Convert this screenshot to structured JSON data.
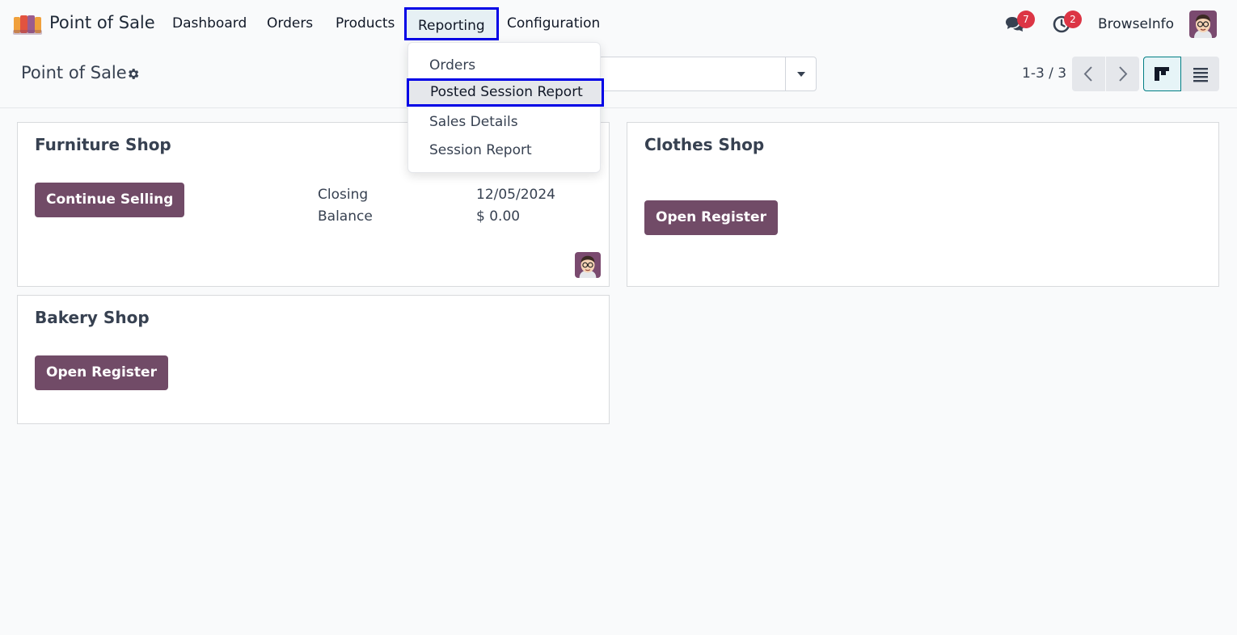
{
  "navbar": {
    "app_name": "Point of Sale",
    "menu": [
      {
        "label": "Dashboard"
      },
      {
        "label": "Orders"
      },
      {
        "label": "Products"
      },
      {
        "label": "Reporting"
      },
      {
        "label": "Configuration"
      }
    ],
    "messages_badge": "7",
    "activities_badge": "2",
    "company": "BrowseInfo"
  },
  "control_panel": {
    "title": "Point of Sale",
    "pager": "1-3 / 3"
  },
  "reporting_menu": {
    "items": [
      {
        "label": "Orders"
      },
      {
        "label": "Posted Session Report"
      },
      {
        "label": "Sales Details"
      },
      {
        "label": "Session Report"
      }
    ]
  },
  "cards": [
    {
      "name": "Furniture Shop",
      "button": "Continue Selling",
      "closing_label": "Closing",
      "closing_value": "12/05/2024",
      "balance_label": "Balance",
      "balance_value": "$ 0.00"
    },
    {
      "name": "Clothes Shop",
      "button": "Open Register"
    },
    {
      "name": "Bakery Shop",
      "button": "Open Register"
    }
  ],
  "colors": {
    "primary": "#714b67",
    "badge": "#dc3545",
    "highlight_outline": "#0000e6"
  }
}
